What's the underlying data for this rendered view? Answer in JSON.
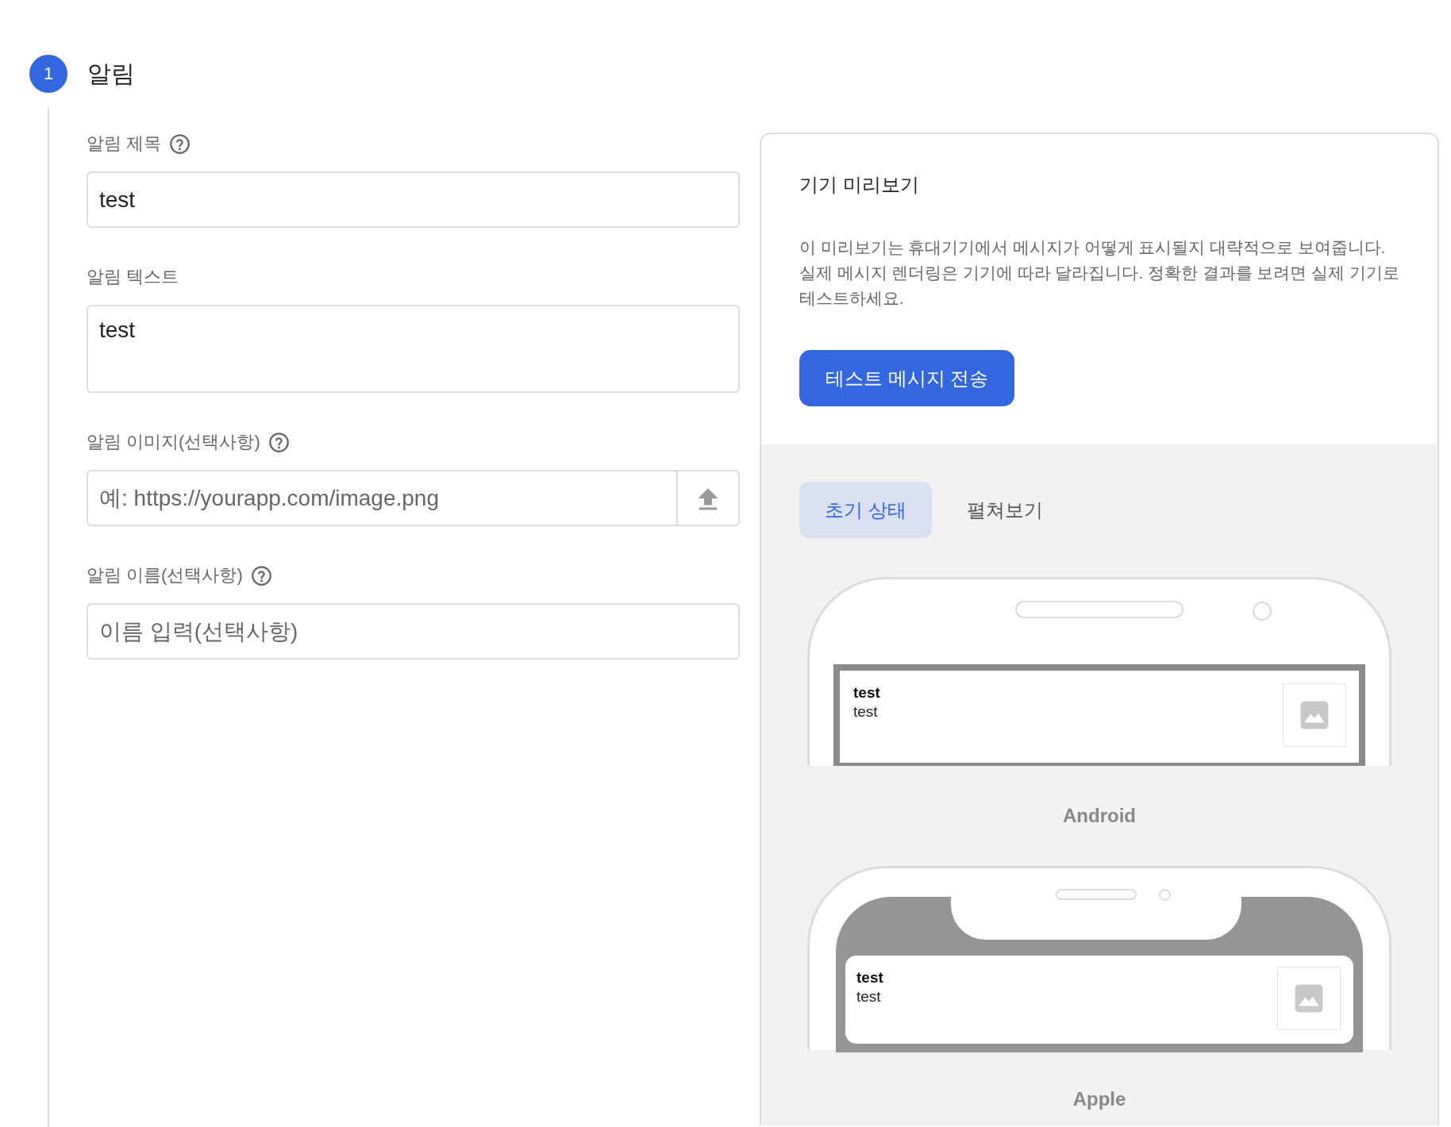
{
  "step": {
    "number": "1",
    "title": "알림"
  },
  "fields": [
    {
      "kind": "input",
      "label": "알림 제목",
      "help": true,
      "value": "test"
    },
    {
      "kind": "textarea",
      "label": "알림 텍스트",
      "help": false,
      "value": "test"
    },
    {
      "kind": "upload",
      "label": "알림 이미지(선택사항)",
      "help": true,
      "placeholder": "예: https://yourapp.com/image.png"
    },
    {
      "kind": "input",
      "label": "알림 이름(선택사항)",
      "help": true,
      "placeholder": "이름 입력(선택사항)"
    }
  ],
  "preview": {
    "title": "기기 미리보기",
    "description": "이 미리보기는 휴대기기에서 메시지가 어떻게 표시될지 대략적으로 보여줍니다. 실제 메시지 렌더링은 기기에 따라 달라집니다. 정확한 결과를 보려면 실제 기기로 테스트하세요.",
    "button": "테스트 메시지 전송",
    "tabs": [
      {
        "label": "초기 상태",
        "selected": true
      },
      {
        "label": "펼쳐보기",
        "selected": false
      }
    ],
    "devices": [
      {
        "kind": "android",
        "label": "Android",
        "notification": {
          "title": "test",
          "body": "test"
        }
      },
      {
        "kind": "apple",
        "label": "Apple",
        "notification": {
          "title": "test",
          "body": "test"
        }
      }
    ]
  }
}
